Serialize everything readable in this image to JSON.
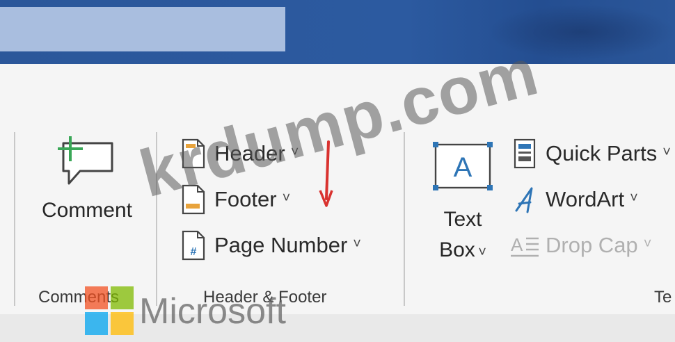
{
  "ribbon": {
    "comments_group": {
      "comment_label": "Comment",
      "group_label": "Comments"
    },
    "header_footer_group": {
      "items": [
        {
          "label": "Header"
        },
        {
          "label": "Footer"
        },
        {
          "label": "Page Number"
        }
      ],
      "group_label": "Header & Footer"
    },
    "text_group": {
      "text_box_line1": "Text",
      "text_box_line2": "Box",
      "items": [
        {
          "label": "Quick Parts"
        },
        {
          "label": "WordArt"
        },
        {
          "label": "Drop Cap"
        }
      ],
      "group_label": "Te"
    }
  },
  "watermark": {
    "text": "krdump.com",
    "brand": "Microsoft"
  },
  "colors": {
    "title_bar": "#2b579a",
    "search_box": "#a9bedf",
    "accent_blue": "#2e75b6",
    "arrow_red": "#d9322f"
  }
}
